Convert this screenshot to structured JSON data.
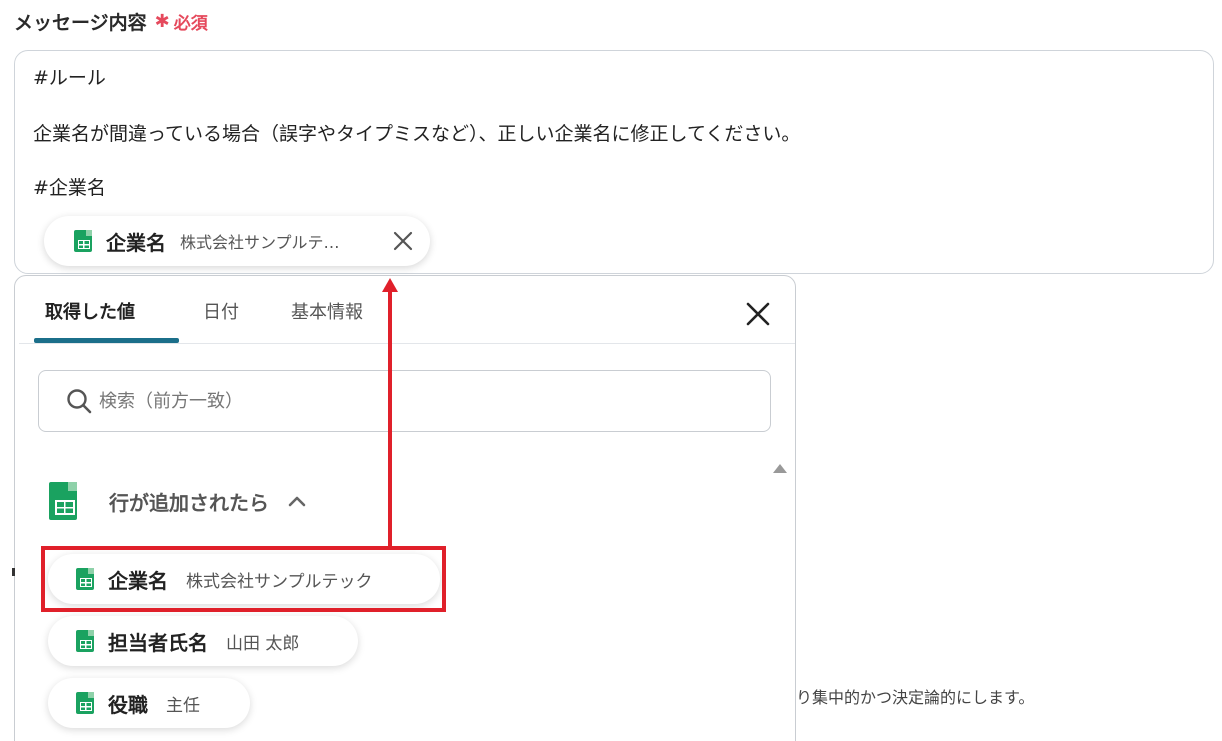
{
  "field": {
    "label": "メッセージ内容",
    "required_star": "✱",
    "required_text": "必須"
  },
  "message": {
    "lines": [
      "#ルール",
      "企業名が間違っている場合（誤字やタイプミスなど）、正しい企業名に修正してください。",
      "#企業名"
    ]
  },
  "inserted_chip": {
    "name": "企業名",
    "value": "株式会社サンプルテ…"
  },
  "dropdown": {
    "tabs": [
      "取得した値",
      "日付",
      "基本情報"
    ],
    "active_tab": "取得した値",
    "search_placeholder": "検索（前方一致）",
    "group": {
      "title": "行が追加されたら",
      "expanded": true,
      "items": [
        {
          "name": "企業名",
          "value": "株式会社サンプルテック"
        },
        {
          "name": "担当者氏名",
          "value": "山田 太郎"
        },
        {
          "name": "役職",
          "value": "主任"
        }
      ]
    }
  },
  "background_text": "り集中的かつ決定論的にします。",
  "colors": {
    "required": "#e5495c",
    "tab_underline": "#1b6f8a",
    "sheet_green": "#1aa260",
    "annotation_red": "#e0202a"
  }
}
